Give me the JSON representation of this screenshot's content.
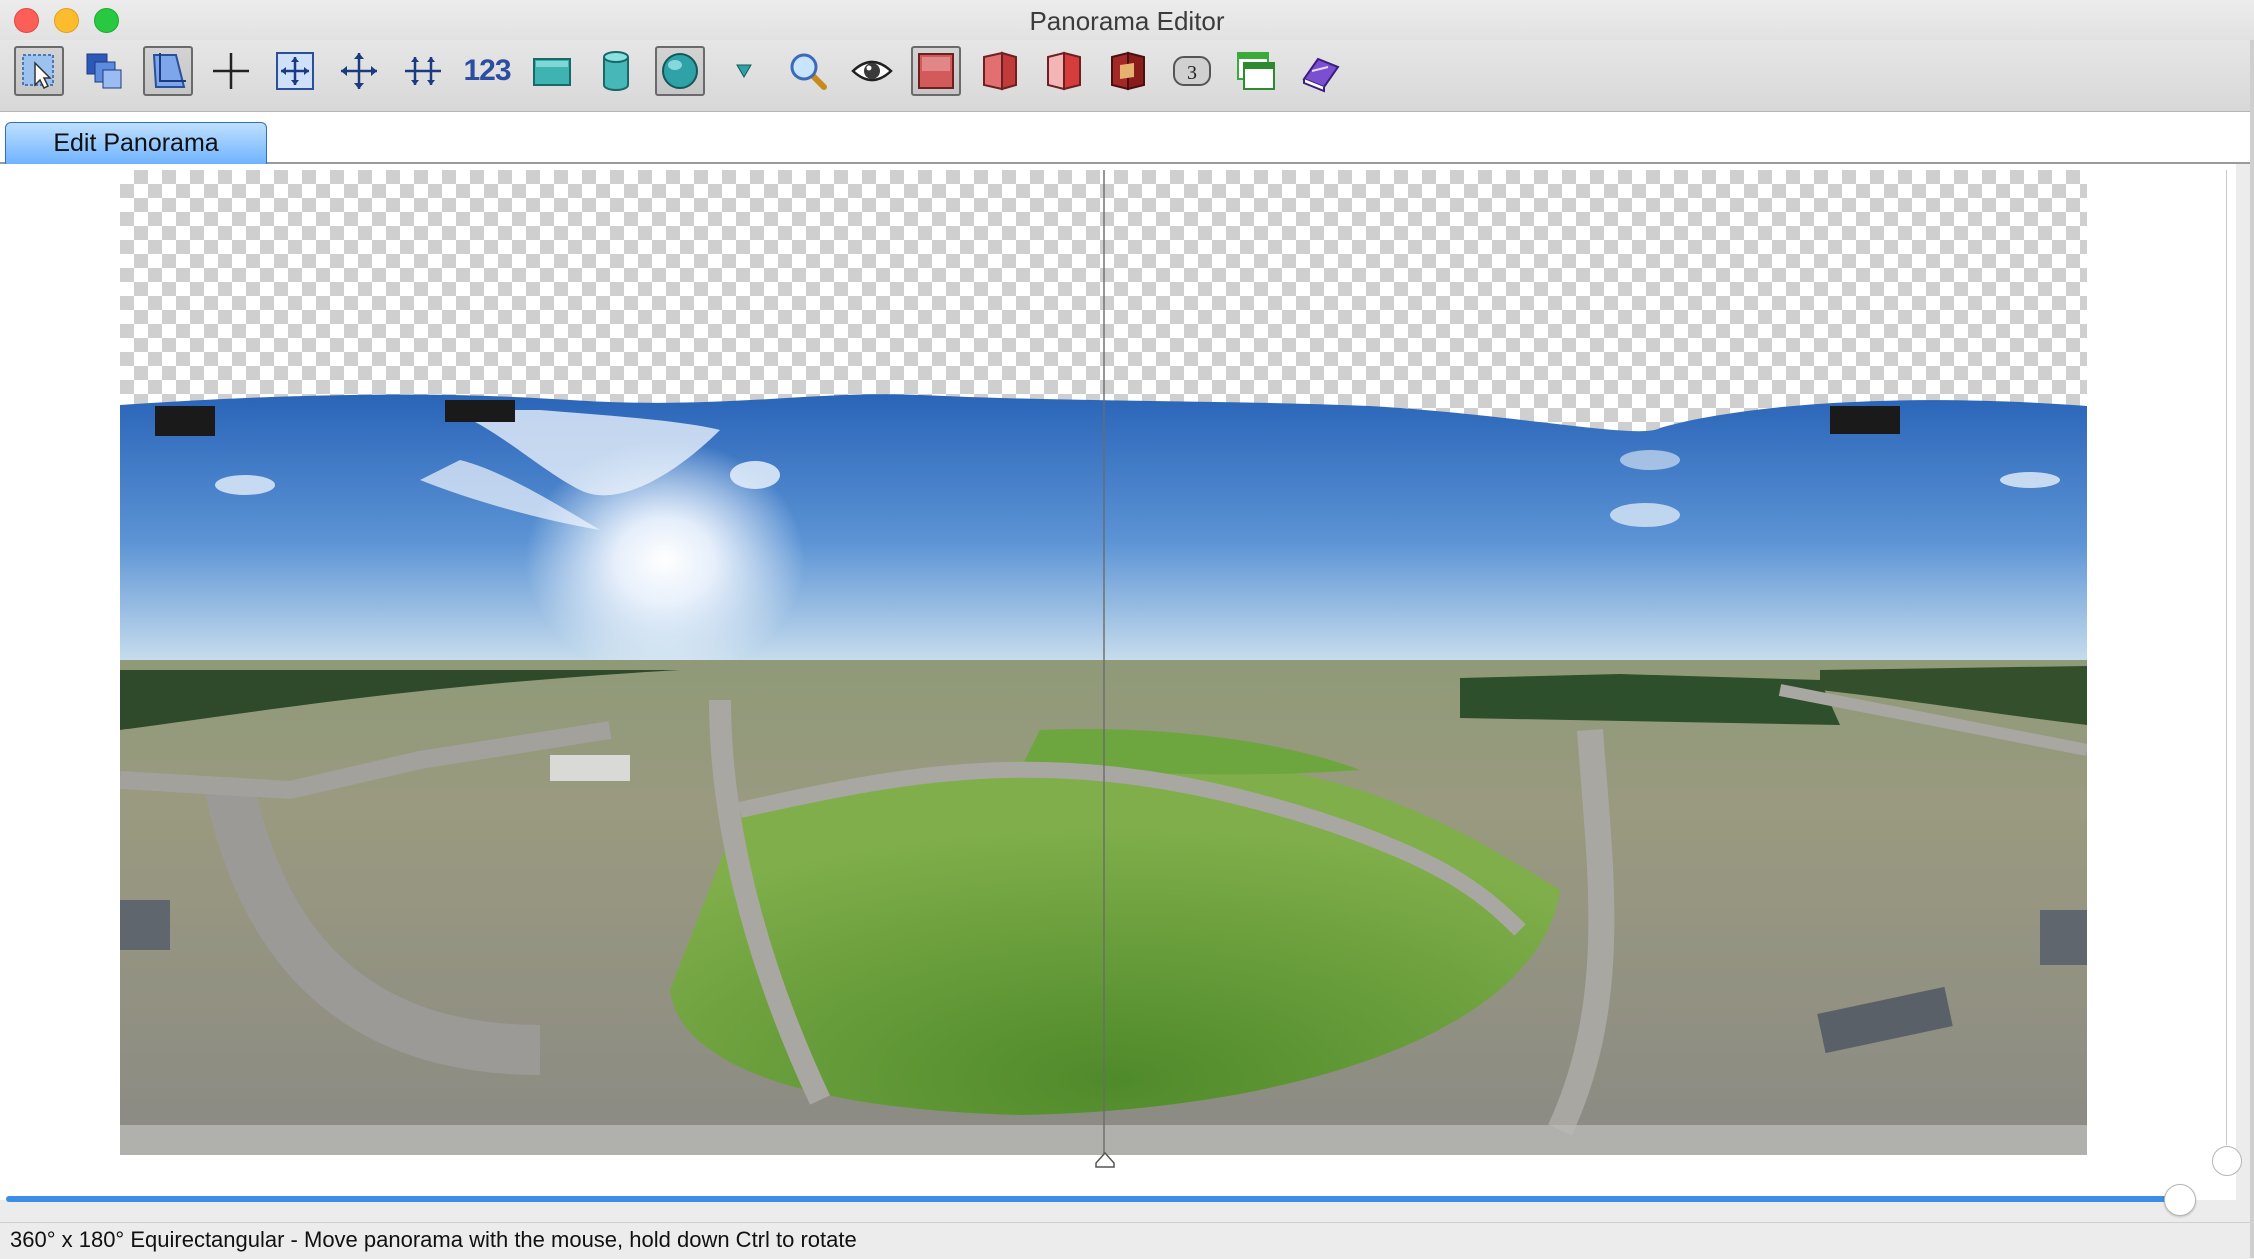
{
  "window": {
    "title": "Panorama Editor"
  },
  "toolbar": {
    "items": [
      {
        "name": "select-tool-icon",
        "selected": true
      },
      {
        "name": "layers-icon"
      },
      {
        "name": "crop-icon",
        "selected": true
      },
      {
        "name": "crosshair-icon"
      },
      {
        "name": "fit-icon"
      },
      {
        "name": "move-icon"
      },
      {
        "name": "straighten-icon"
      },
      {
        "name": "numbers-tool",
        "label": "123"
      },
      {
        "name": "flat-projection-icon"
      },
      {
        "name": "cylinder-projection-icon"
      },
      {
        "name": "sphere-projection-icon",
        "selected": true
      },
      {
        "name": "dropdown-arrow-icon"
      },
      {
        "name": "zoom-icon"
      },
      {
        "name": "preview-eye-icon"
      },
      {
        "name": "frame-icon",
        "selected": true
      },
      {
        "name": "page-left-icon"
      },
      {
        "name": "page-right-icon"
      },
      {
        "name": "page-dark-icon"
      },
      {
        "name": "badge-icon",
        "label": "3"
      },
      {
        "name": "window-icon"
      },
      {
        "name": "book-icon"
      }
    ]
  },
  "tabs": [
    {
      "label": "Edit Panorama",
      "active": true
    }
  ],
  "status": {
    "text": "360° x 180° Equirectangular - Move panorama with the mouse, hold down Ctrl to rotate"
  },
  "slider": {
    "value": 1.0
  },
  "colors": {
    "accent": "#3a8ee6",
    "sky_top": "#2f6cbf",
    "sky_horizon": "#c9dbea",
    "grass": "#5e8f35"
  }
}
